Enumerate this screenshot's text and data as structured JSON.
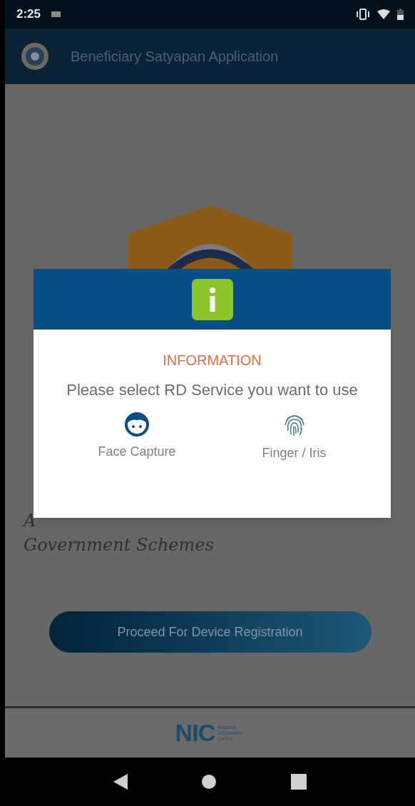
{
  "status_bar": {
    "time": "2:25"
  },
  "app_bar": {
    "title": "Beneficiary Satyapan Application"
  },
  "background": {
    "tagline_lines": [
      "A",
      "Government Schemes"
    ],
    "button": "Proceed For Device Registration",
    "footer_logo": {
      "mark": "NIC",
      "subtitle": "National Informatics Centre"
    }
  },
  "dialog": {
    "title": "INFORMATION",
    "message": "Please select RD Service you want to use",
    "options": [
      {
        "kind": "face",
        "label": "Face Capture"
      },
      {
        "kind": "finger",
        "label": "Finger / Iris"
      }
    ]
  }
}
